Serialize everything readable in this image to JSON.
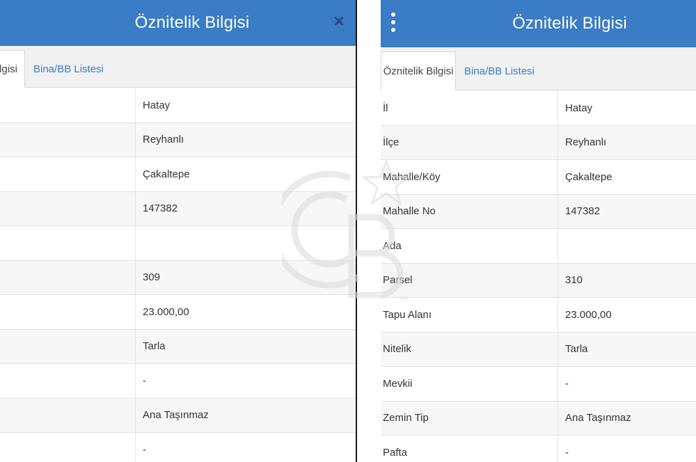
{
  "left_panel": {
    "header": {
      "title": "Öznitelik Bilgisi",
      "close_glyph": "×"
    },
    "tabs": [
      {
        "label": "lgisi",
        "active": true
      },
      {
        "label": "Bina/BB Listesi",
        "active": false
      }
    ],
    "rows": [
      {
        "value": "Hatay"
      },
      {
        "value": "Reyhanlı"
      },
      {
        "value": "Çakaltepe"
      },
      {
        "value": "147382"
      },
      {
        "value": ""
      },
      {
        "value": "309"
      },
      {
        "value": "23.000,00"
      },
      {
        "value": "Tarla"
      },
      {
        "value": "-"
      },
      {
        "value": "Ana Taşınmaz"
      },
      {
        "value": "-"
      }
    ]
  },
  "right_panel": {
    "header": {
      "title": "Öznitelik Bilgisi"
    },
    "tabs": [
      {
        "label": "Öznitelik Bilgisi",
        "active": true
      },
      {
        "label": "Bina/BB Listesi",
        "active": false
      }
    ],
    "rows": [
      {
        "label": "İl",
        "value": "Hatay"
      },
      {
        "label": "İlçe",
        "value": "Reyhanlı"
      },
      {
        "label": "Mahalle/Köy",
        "value": "Çakaltepe"
      },
      {
        "label": "Mahalle No",
        "value": "147382"
      },
      {
        "label": "Ada",
        "value": ""
      },
      {
        "label": "Parsel",
        "value": "310"
      },
      {
        "label": "Tapu Alanı",
        "value": "23.000,00"
      },
      {
        "label": "Nitelik",
        "value": "Tarla"
      },
      {
        "label": "Mevkii",
        "value": "-"
      },
      {
        "label": "Zemin Tip",
        "value": "Ana Taşınmaz"
      },
      {
        "label": "Pafta",
        "value": "-"
      }
    ]
  },
  "watermark": {
    "text": "CB",
    "mark": "SM"
  },
  "colors": {
    "header": "#3a7cc5",
    "link": "#3a7cc5",
    "close_icon": "#234a74"
  }
}
